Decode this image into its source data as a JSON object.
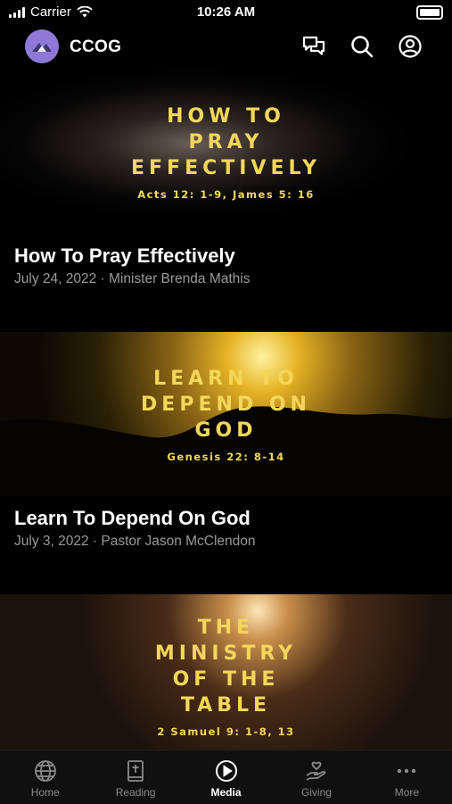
{
  "status_bar": {
    "carrier": "Carrier",
    "time": "10:26 AM"
  },
  "header": {
    "app_name": "CCOG"
  },
  "feed": {
    "items": [
      {
        "thumb_lines": [
          "HOW TO",
          "PRAY",
          "EFFECTIVELY"
        ],
        "thumb_ref": "Acts 12: 1-9, James 5: 16",
        "title": "How To Pray Effectively",
        "subtitle": "July 24, 2022 · Minister Brenda Mathis"
      },
      {
        "thumb_lines": [
          "LEARN TO",
          "DEPEND ON",
          "GOD"
        ],
        "thumb_ref": "Genesis 22: 8-14",
        "title": "Learn To Depend On God",
        "subtitle": "July 3, 2022 · Pastor Jason McClendon"
      },
      {
        "thumb_lines": [
          "THE",
          "MINISTRY",
          "OF THE",
          "TABLE"
        ],
        "thumb_ref": "2 Samuel 9: 1-8, 13"
      }
    ]
  },
  "tabbar": {
    "tabs": [
      {
        "label": "Home",
        "icon": "globe-icon"
      },
      {
        "label": "Reading",
        "icon": "bible-icon"
      },
      {
        "label": "Media",
        "icon": "play-circle-icon",
        "active": true
      },
      {
        "label": "Giving",
        "icon": "giving-hand-icon"
      },
      {
        "label": "More",
        "icon": "more-dots-icon"
      }
    ]
  },
  "colors": {
    "accent_text": "#f4d75a",
    "avatar_bg": "#8e7ad6",
    "tab_inactive": "#8b8b8b"
  }
}
